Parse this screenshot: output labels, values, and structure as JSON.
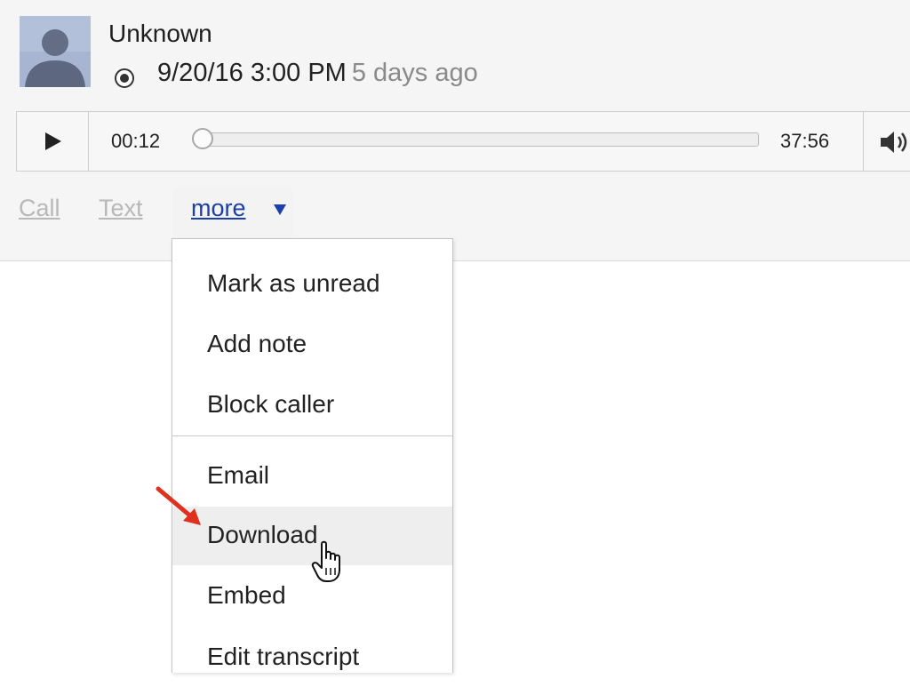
{
  "contact": {
    "name": "Unknown",
    "call_time": "9/20/16 3:00 PM",
    "call_age": "5 days ago"
  },
  "player": {
    "current_time": "00:12",
    "total_time": "37:56",
    "progress": 0.005
  },
  "actions": {
    "call_label": "Call",
    "text_label": "Text",
    "more_label": "more"
  },
  "menu": {
    "items": [
      {
        "label": "Mark as unread"
      },
      {
        "label": "Add note"
      },
      {
        "label": "Block caller"
      },
      {
        "label": "Email"
      },
      {
        "label": "Download"
      },
      {
        "label": "Embed"
      },
      {
        "label": "Edit transcript"
      }
    ],
    "highlighted_item": "Download"
  },
  "icons": {
    "avatar": "person-silhouette-icon",
    "radio": "radio-selected-icon",
    "play": "play-icon",
    "volume": "volume-icon",
    "caret": "caret-down-icon",
    "cursor": "hand-pointer-icon",
    "annotation": "red-arrow-icon"
  },
  "colors": {
    "link": "#1c3fa8",
    "annotation_arrow": "#e0301e",
    "menu_highlight": "#eeeeee"
  }
}
